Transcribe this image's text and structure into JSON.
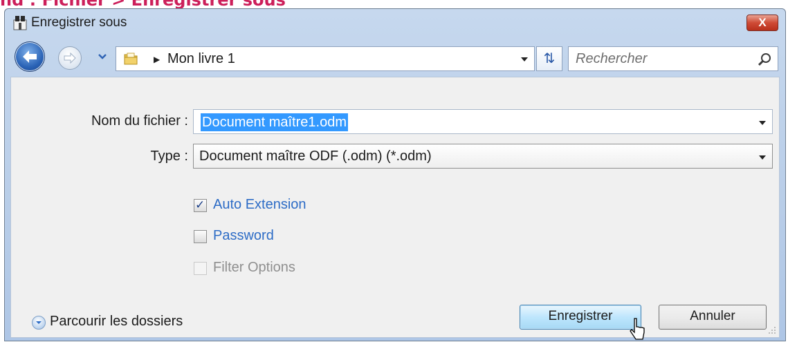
{
  "banner": "nd : Fichier > Enregistrer sous",
  "window": {
    "title": "Enregistrer sous",
    "close_label": "X"
  },
  "nav": {
    "breadcrumb": "Mon livre 1",
    "search_placeholder": "Rechercher"
  },
  "form": {
    "filename_label": "Nom du fichier :",
    "filename_value": "Document maître1.odm",
    "type_label": "Type :",
    "type_value": "Document maître ODF (.odm) (*.odm)"
  },
  "options": [
    {
      "label": "Auto Extension",
      "checked": true,
      "enabled": true
    },
    {
      "label": "Password",
      "checked": false,
      "enabled": true
    },
    {
      "label": "Filter Options",
      "checked": false,
      "enabled": false
    }
  ],
  "footer": {
    "browse_label": "Parcourir les dossiers",
    "save_label": "Enregistrer",
    "cancel_label": "Annuler"
  },
  "colors": {
    "accent": "#cc1f5a",
    "link_blue": "#2d6cc6",
    "selection": "#3399ff"
  },
  "icons": [
    "app-icon",
    "back-arrow-icon",
    "forward-arrow-icon",
    "chevron-down-icon",
    "folder-icon",
    "refresh-icon",
    "search-icon",
    "expand-icon",
    "pointer-cursor-icon",
    "resize-grip-icon"
  ]
}
